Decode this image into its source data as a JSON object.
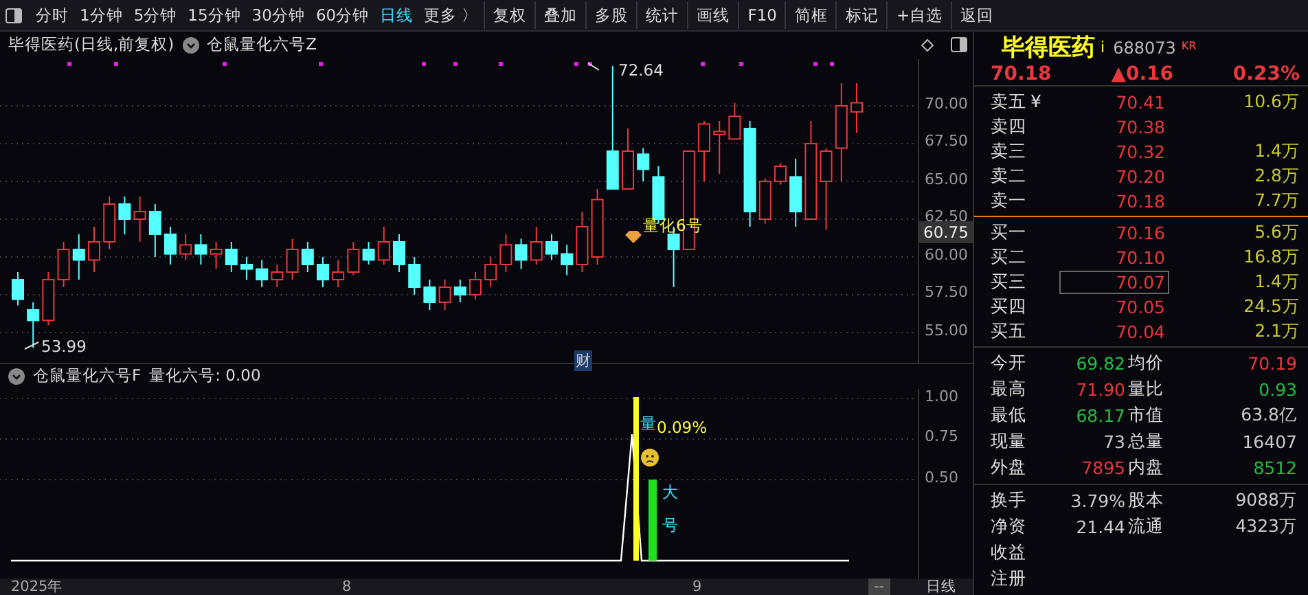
{
  "toolbar": {
    "items": [
      {
        "label": "分时",
        "selected": false
      },
      {
        "label": "1分钟",
        "selected": false
      },
      {
        "label": "5分钟",
        "selected": false
      },
      {
        "label": "15分钟",
        "selected": false
      },
      {
        "label": "30分钟",
        "selected": false
      },
      {
        "label": "60分钟",
        "selected": false
      },
      {
        "label": "日线",
        "selected": true
      },
      {
        "label": "更多 〉",
        "selected": false
      }
    ],
    "buttons": [
      "复权",
      "叠加",
      "多股",
      "统计",
      "画线",
      "F10",
      "简框",
      "标记",
      "+自选",
      "返回"
    ]
  },
  "chart_header": {
    "title": "毕得医药(日线,前复权)",
    "indicator": "仓鼠量化六号Z"
  },
  "price_chart": {
    "chart_data": {
      "type": "candlestick",
      "ylim": [
        52.91,
        73.09
      ],
      "grid": true,
      "yticks": [
        {
          "value": 70,
          "label": "70.00"
        },
        {
          "value": 67.5,
          "label": "67.50"
        },
        {
          "value": 65,
          "label": "65.00"
        },
        {
          "value": 62.5,
          "label": "62.50"
        },
        {
          "value": 60,
          "label": "60.00"
        },
        {
          "value": 57.5,
          "label": "57.50"
        },
        {
          "value": 55,
          "label": "55.00"
        }
      ],
      "ohlc": [
        [
          58.5,
          59,
          56.8,
          57.2
        ],
        [
          56.5,
          57,
          53.99,
          55.8
        ],
        [
          55.8,
          59,
          55.5,
          58.5
        ],
        [
          58.5,
          61,
          58,
          60.5
        ],
        [
          60.5,
          61.5,
          58.5,
          59.8
        ],
        [
          59.8,
          62,
          59,
          61
        ],
        [
          61,
          64,
          60.5,
          63.5
        ],
        [
          63.5,
          64,
          61.5,
          62.5
        ],
        [
          62.5,
          64,
          61,
          63
        ],
        [
          63,
          63.5,
          60,
          61.5
        ],
        [
          61.5,
          62,
          59.5,
          60.2
        ],
        [
          60.2,
          61.5,
          59.8,
          60.8
        ],
        [
          60.8,
          61.5,
          59.5,
          60.2
        ],
        [
          60.2,
          61,
          59.2,
          60.5
        ],
        [
          60.5,
          61,
          59,
          59.5
        ],
        [
          59.5,
          60,
          58.5,
          59.2
        ],
        [
          59.2,
          59.8,
          58,
          58.5
        ],
        [
          58.5,
          59.5,
          58,
          59
        ],
        [
          59,
          61.2,
          58.5,
          60.5
        ],
        [
          60.5,
          61,
          59,
          59.5
        ],
        [
          59.5,
          60,
          58,
          58.5
        ],
        [
          58.5,
          59.8,
          58,
          59
        ],
        [
          59,
          61,
          58.8,
          60.5
        ],
        [
          60.5,
          61,
          59.5,
          59.8
        ],
        [
          59.8,
          62,
          59.5,
          61
        ],
        [
          61,
          61.5,
          59,
          59.5
        ],
        [
          59.5,
          60,
          57.5,
          58
        ],
        [
          58,
          58.5,
          56.5,
          57
        ],
        [
          57,
          58.5,
          56.5,
          58
        ],
        [
          58,
          58.5,
          57,
          57.5
        ],
        [
          57.5,
          59,
          57.2,
          58.5
        ],
        [
          58.5,
          60,
          58,
          59.5
        ],
        [
          59.5,
          61.5,
          59,
          60.8
        ],
        [
          60.8,
          61.2,
          59.2,
          59.8
        ],
        [
          59.8,
          62,
          59.5,
          61
        ],
        [
          61,
          61.5,
          59.8,
          60.2
        ],
        [
          60.2,
          60.8,
          58.8,
          59.5
        ],
        [
          59.5,
          63,
          59,
          62
        ],
        [
          60,
          64.5,
          59.5,
          63.8
        ],
        [
          67,
          72.64,
          64.5,
          64.5
        ],
        [
          64.5,
          68.5,
          64.5,
          67
        ],
        [
          66.8,
          67.2,
          65,
          65.8
        ],
        [
          65.3,
          66,
          62.2,
          62.5
        ],
        [
          61.5,
          62,
          58,
          60.5
        ],
        [
          60.5,
          67,
          60.5,
          67
        ],
        [
          67,
          69,
          65,
          68.8
        ],
        [
          68.1,
          69,
          65.5,
          68.3
        ],
        [
          67.8,
          70.2,
          67.8,
          69.3
        ],
        [
          68.5,
          69,
          62,
          63
        ],
        [
          62.5,
          65.2,
          62.2,
          65
        ],
        [
          65,
          66.2,
          64.8,
          66
        ],
        [
          65.3,
          66.5,
          62,
          63
        ],
        [
          62.5,
          69,
          62.5,
          67.5
        ],
        [
          65,
          67.2,
          61.8,
          67
        ],
        [
          67.2,
          71.5,
          65,
          70
        ],
        [
          69.6,
          71.5,
          68.2,
          70.2
        ]
      ]
    },
    "high_label": "72.64",
    "low_label": "53.99",
    "current_price": "60.75",
    "signal_label": "量化6号",
    "event_marker": "财"
  },
  "indicator_panel": {
    "title": "仓鼠量化六号F",
    "reading": "量化六号: 0.00",
    "yticks": [
      "1.00",
      "0.75",
      "0.50"
    ],
    "percent_label": "0.09%",
    "vertical_marks": [
      "量",
      "大",
      "号"
    ]
  },
  "time_axis": {
    "labels": [
      "2025年",
      "8",
      "9"
    ],
    "cursor": "--",
    "period": "日线"
  },
  "quote": {
    "name": "毕得医药",
    "flag": "i",
    "code": "688073",
    "tag": "KR",
    "price": "70.18",
    "change": "▲0.16",
    "percent": "0.23%"
  },
  "asks": [
    {
      "label": "卖五",
      "currency": "¥",
      "price": "70.41",
      "volume": "10.6万",
      "selected": false
    },
    {
      "label": "卖四",
      "price": "70.38",
      "selected": false
    },
    {
      "label": "卖三",
      "price": "70.32",
      "volume": "1.4万",
      "selected": false
    },
    {
      "label": "卖二",
      "price": "70.20",
      "volume": "2.8万",
      "selected": false
    },
    {
      "label": "卖一",
      "price": "70.18",
      "volume": "7.7万",
      "selected": false
    }
  ],
  "bids": [
    {
      "label": "买一",
      "price": "70.16",
      "volume": "5.6万",
      "selected": false
    },
    {
      "label": "买二",
      "price": "70.10",
      "volume": "16.8万",
      "selected": false
    },
    {
      "label": "买三",
      "price": "70.07",
      "volume": "1.4万",
      "selected": true
    },
    {
      "label": "买四",
      "price": "70.05",
      "volume": "24.5万",
      "selected": false
    },
    {
      "label": "买五",
      "price": "70.04",
      "volume": "2.1万",
      "selected": false
    }
  ],
  "stats": [
    [
      {
        "label": "今开",
        "value": "69.82",
        "color": "#20c040"
      },
      {
        "label": "均价",
        "value": "70.19",
        "color": "#e8383d"
      }
    ],
    [
      {
        "label": "最高",
        "value": "71.90",
        "color": "#e8383d"
      },
      {
        "label": "量比",
        "value": "0.93",
        "color": "#20c040"
      }
    ],
    [
      {
        "label": "最低",
        "value": "68.17",
        "color": "#20c040"
      },
      {
        "label": "市值",
        "value": "63.8亿",
        "color": "#cccccc"
      }
    ],
    [
      {
        "label": "现量",
        "value": "73",
        "color": "#cccccc"
      },
      {
        "label": "总量",
        "value": "16407",
        "color": "#cccccc"
      }
    ],
    [
      {
        "label": "外盘",
        "value": "7895",
        "color": "#e8383d"
      },
      {
        "label": "内盘",
        "value": "8512",
        "color": "#20c040"
      }
    ]
  ],
  "fundamentals": [
    [
      {
        "label": "换手",
        "value": "3.79%"
      },
      {
        "label": "股本",
        "value": "9088万"
      }
    ],
    [
      {
        "label": "净资",
        "value": "21.44"
      },
      {
        "label": "流通",
        "value": "4323万"
      }
    ],
    [
      {
        "label": "收益"
      }
    ],
    [
      {
        "label": "注册"
      }
    ]
  ]
}
